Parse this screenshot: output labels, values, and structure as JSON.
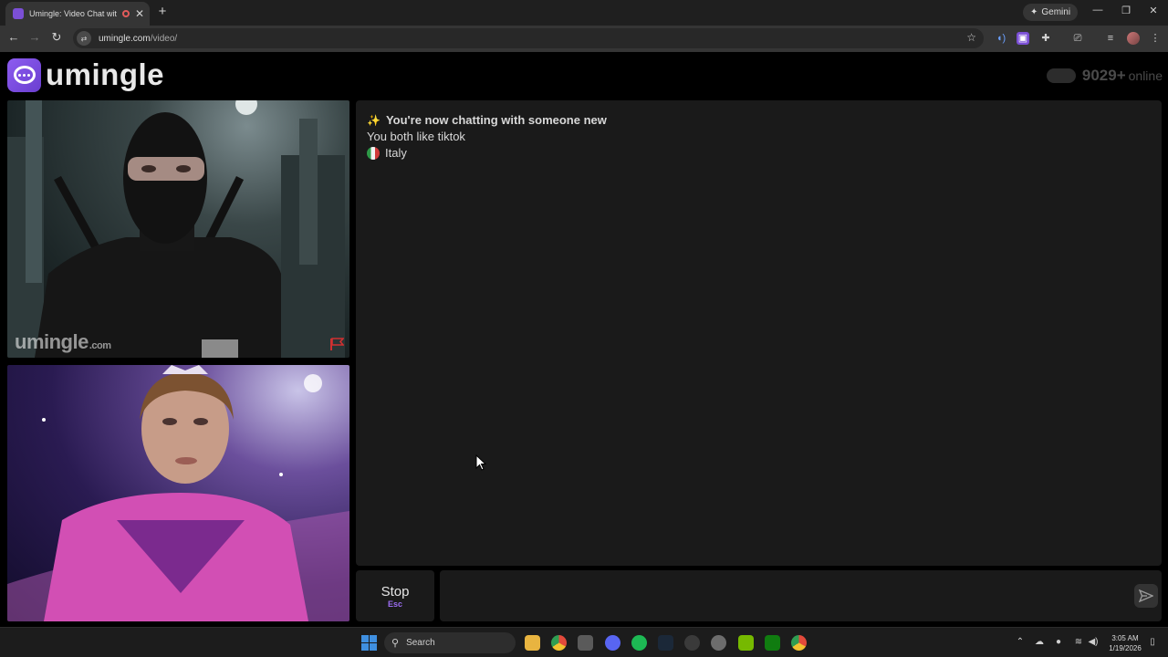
{
  "browser": {
    "tab_title": "Umingle: Video Chat with S",
    "new_tab": "+",
    "gemini_label": "Gemini",
    "url_host": "umingle.com",
    "url_path": "/video/"
  },
  "site": {
    "logo_text": "umingle",
    "online_count": "9029+",
    "online_label": "online",
    "watermark_brand": "umingle",
    "watermark_suffix": ".com"
  },
  "chat": {
    "header": "You're now chatting with someone new",
    "common_interest": "You both like tiktok",
    "country": "Italy"
  },
  "controls": {
    "stop_label": "Stop",
    "stop_shortcut": "Esc",
    "message_placeholder": ""
  },
  "taskbar": {
    "search_label": "Search",
    "time": "3:05 AM",
    "date": "1/19/2026"
  },
  "colors": {
    "accent": "#8d5cf0",
    "panel": "#1a1a1a",
    "report_flag": "#d03030"
  }
}
